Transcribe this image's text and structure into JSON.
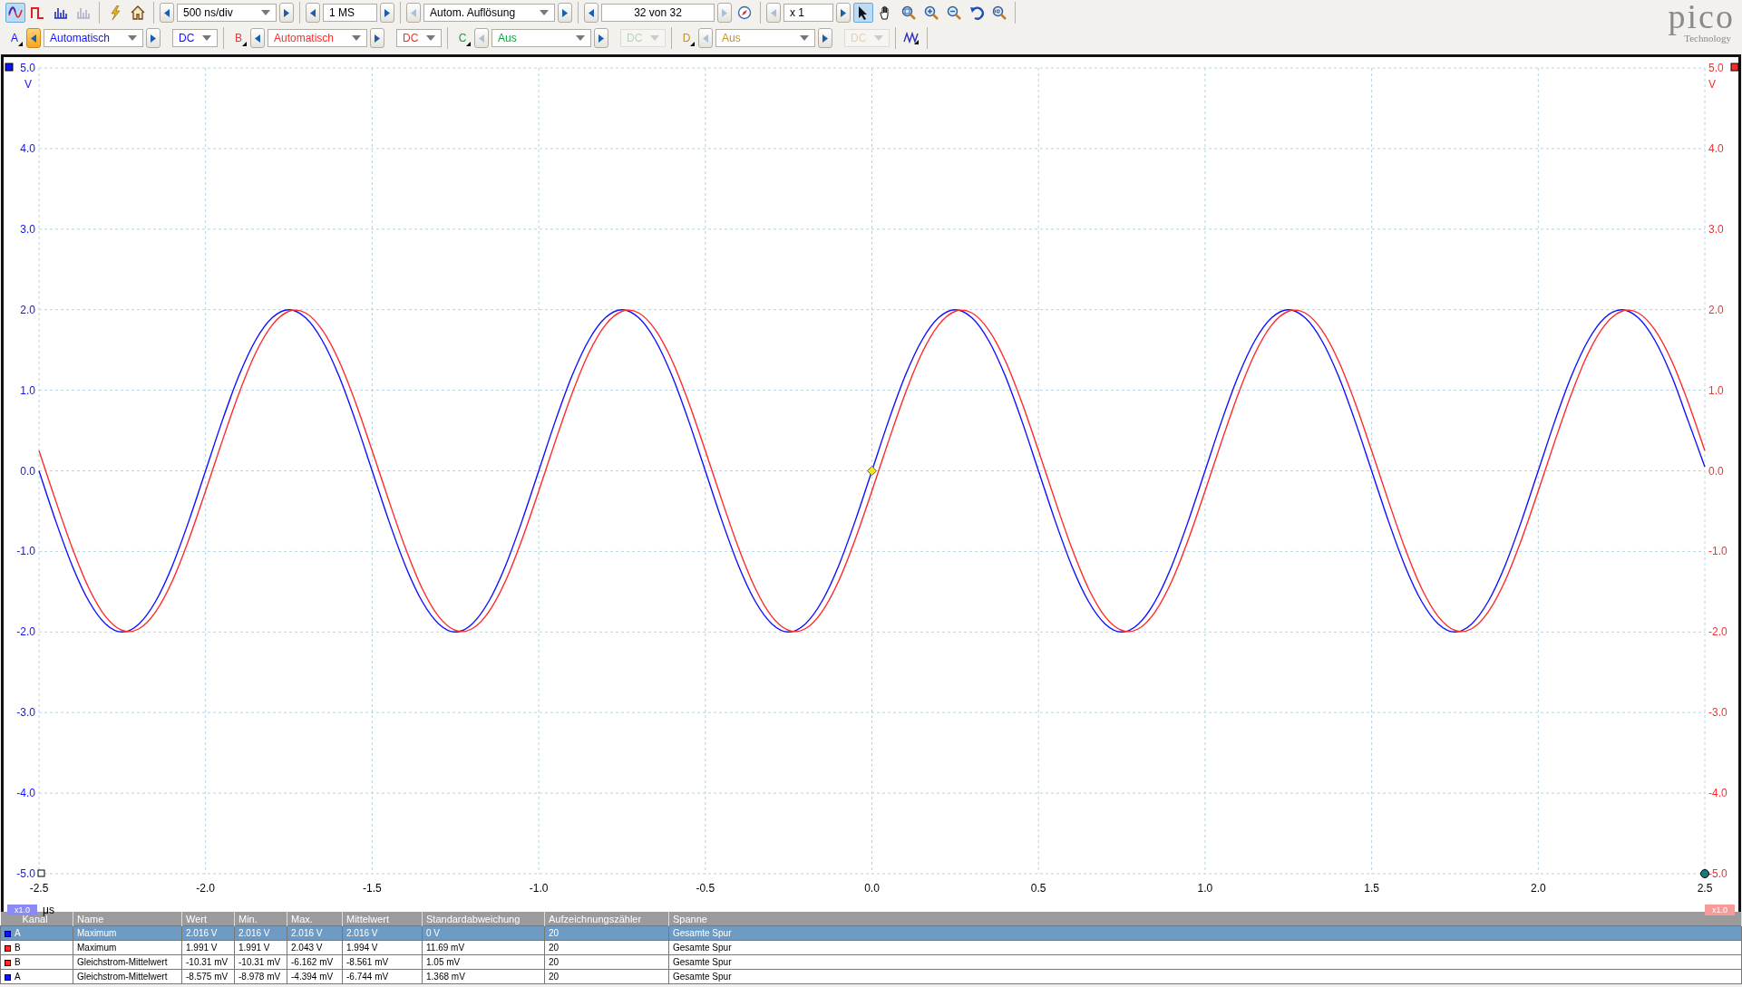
{
  "toolbar": {
    "modes": [
      {
        "kind": "scope",
        "selected": true
      },
      {
        "kind": "persistence",
        "selected": false
      },
      {
        "kind": "spectrum",
        "selected": false
      }
    ],
    "timebase": {
      "value": "500 ns/div",
      "prev_disabled": false,
      "next_disabled": false
    },
    "samples": {
      "value": "1 MS",
      "prev_disabled": false,
      "next_disabled": false
    },
    "resolution": {
      "value": "Autom. Auflösung",
      "prev_disabled": true,
      "next_disabled": false
    },
    "buffer": {
      "value": "32 von 32",
      "prev_disabled": false,
      "next_disabled": true
    },
    "zoom": {
      "value": "x 1",
      "prev_disabled": true,
      "next_disabled": false
    },
    "tools": [
      {
        "kind": "pointer",
        "selected": true
      },
      {
        "kind": "hand",
        "selected": false
      },
      {
        "kind": "zoom-area",
        "selected": false
      },
      {
        "kind": "zoom-in",
        "selected": false
      },
      {
        "kind": "zoom-out",
        "selected": false
      },
      {
        "kind": "undo",
        "selected": false
      },
      {
        "kind": "zoom-fit",
        "selected": false
      }
    ]
  },
  "channels": [
    {
      "label": "A",
      "color": "#1010ff",
      "range": "Automatisch",
      "coupling": "DC",
      "enabled": true,
      "prev_highlighted": true
    },
    {
      "label": "B",
      "color": "#ff2a2a",
      "range": "Automatisch",
      "coupling": "DC",
      "enabled": true,
      "prev_highlighted": false
    },
    {
      "label": "C",
      "color": "#10a040",
      "range": "Aus",
      "coupling": "DC",
      "enabled": false,
      "prev_highlighted": false
    },
    {
      "label": "D",
      "color": "#c89020",
      "range": "Aus",
      "coupling": "DC",
      "enabled": false,
      "prev_highlighted": false
    }
  ],
  "logo": {
    "name": "pico",
    "tagline": "Technology"
  },
  "plot": {
    "scale_left": "x1.0",
    "scale_right": "x1.0",
    "right_ylabel": "V",
    "right_yticks": [
      "5.0",
      "4.0",
      "3.0",
      "2.0",
      "1.0",
      "0.0",
      "-1.0",
      "-2.0",
      "-3.0",
      "-4.0",
      "-5.0"
    ],
    "chart_data": {
      "type": "line",
      "grid": true,
      "xlabel": "μs",
      "ylabel": "V",
      "xlim": [
        -2.5,
        2.5
      ],
      "ylim": [
        -5,
        5
      ],
      "xticks": [
        -2.5,
        {
          "value": -2,
          "label": "-2.0"
        },
        -1.5,
        {
          "value": -1,
          "label": "-1.0"
        },
        -0.5,
        {
          "value": 0,
          "label": "0.0"
        },
        0.5,
        {
          "value": 1,
          "label": "1.0"
        },
        1.5,
        {
          "value": 2,
          "label": "2.0"
        },
        2.5
      ],
      "yticks": [
        {
          "value": -5,
          "label": "-5.0"
        },
        {
          "value": -4,
          "label": "-4.0"
        },
        {
          "value": -3,
          "label": "-3.0"
        },
        {
          "value": -2,
          "label": "-2.0"
        },
        {
          "value": -1,
          "label": "-1.0"
        },
        {
          "value": 0,
          "label": "0.0"
        },
        {
          "value": 1,
          "label": "1.0"
        },
        {
          "value": 2,
          "label": "2.0"
        },
        {
          "value": 3,
          "label": "3.0"
        },
        {
          "value": 4,
          "label": "4.0"
        },
        {
          "value": 5,
          "label": "5.0"
        }
      ],
      "x": [
        -2.5,
        -2.45,
        -2.4,
        -2.35,
        -2.3,
        -2.25,
        -2.2,
        -2.15,
        -2.1,
        -2.05,
        -2,
        -1.95,
        -1.9,
        -1.85,
        -1.8,
        -1.75,
        -1.7,
        -1.65,
        -1.6,
        -1.55,
        -1.5,
        -1.45,
        -1.4,
        -1.35,
        -1.3,
        -1.25,
        -1.2,
        -1.15,
        -1.1,
        -1.05,
        -1,
        -0.95,
        -0.9,
        -0.85,
        -0.8,
        -0.75,
        -0.7,
        -0.65,
        -0.6,
        -0.55,
        -0.5,
        -0.45,
        -0.4,
        -0.35,
        -0.3,
        -0.25,
        -0.2,
        -0.15,
        -0.1,
        -0.05,
        0,
        0.05,
        0.1,
        0.15,
        0.2,
        0.25,
        0.3,
        0.35,
        0.4,
        0.45,
        0.5,
        0.55,
        0.6,
        0.65,
        0.7,
        0.75,
        0.8,
        0.85,
        0.9,
        0.95,
        1,
        1.05,
        1.1,
        1.15,
        1.2,
        1.25,
        1.3,
        1.35,
        1.4,
        1.45,
        1.5,
        1.55,
        1.6,
        1.65,
        1.7,
        1.75,
        1.8,
        1.85,
        1.9,
        1.95,
        2,
        2.05,
        2.1,
        2.15,
        2.2,
        2.25,
        2.3,
        2.35,
        2.4,
        2.45,
        2.5
      ],
      "series": [
        {
          "color": "#1010ff",
          "values": [
            0,
            -0.62,
            -1.18,
            -1.62,
            -1.9,
            -2,
            -1.9,
            -1.62,
            -1.18,
            -0.62,
            0,
            0.62,
            1.18,
            1.62,
            1.9,
            2,
            1.9,
            1.62,
            1.18,
            0.62,
            0,
            -0.62,
            -1.18,
            -1.62,
            -1.9,
            -2,
            -1.9,
            -1.62,
            -1.18,
            -0.62,
            0,
            0.62,
            1.18,
            1.62,
            1.9,
            2,
            1.9,
            1.62,
            1.18,
            0.62,
            0,
            -0.62,
            -1.18,
            -1.62,
            -1.9,
            -2,
            -1.9,
            -1.62,
            -1.18,
            -0.62,
            0,
            0.62,
            1.18,
            1.62,
            1.9,
            2,
            1.9,
            1.62,
            1.18,
            0.62,
            0,
            -0.62,
            -1.18,
            -1.62,
            -1.9,
            -2,
            -1.9,
            -1.62,
            -1.18,
            -0.62,
            0,
            0.62,
            1.18,
            1.62,
            1.9,
            2,
            1.9,
            1.62,
            1.18,
            0.62,
            0,
            -0.62,
            -1.18,
            -1.62,
            -1.9,
            -2,
            -1.9,
            -1.62,
            -1.18,
            -0.62,
            0,
            0.62,
            1.18,
            1.62,
            1.9,
            2,
            1.9,
            1.62,
            1.18,
            0.62,
            0.05
          ]
        },
        {
          "color": "#ff2a2a",
          "values": [
            0.25,
            -0.37,
            -0.96,
            -1.46,
            -1.81,
            -1.98,
            -1.96,
            -1.75,
            -1.37,
            -0.85,
            -0.25,
            0.37,
            0.96,
            1.46,
            1.81,
            1.98,
            1.96,
            1.75,
            1.37,
            0.85,
            0.25,
            -0.37,
            -0.96,
            -1.46,
            -1.81,
            -1.98,
            -1.96,
            -1.75,
            -1.37,
            -0.85,
            -0.25,
            0.37,
            0.96,
            1.46,
            1.81,
            1.98,
            1.96,
            1.75,
            1.37,
            0.85,
            0.25,
            -0.37,
            -0.96,
            -1.46,
            -1.81,
            -1.98,
            -1.96,
            -1.75,
            -1.37,
            -0.85,
            -0.25,
            0.37,
            0.96,
            1.46,
            1.81,
            1.98,
            1.96,
            1.75,
            1.37,
            0.85,
            0.25,
            -0.37,
            -0.96,
            -1.46,
            -1.81,
            -1.98,
            -1.96,
            -1.75,
            -1.37,
            -0.85,
            -0.25,
            0.37,
            0.96,
            1.46,
            1.81,
            1.98,
            1.96,
            1.75,
            1.37,
            0.85,
            0.25,
            -0.37,
            -0.96,
            -1.46,
            -1.81,
            -1.98,
            -1.96,
            -1.75,
            -1.37,
            -0.85,
            -0.25,
            0.37,
            0.96,
            1.46,
            1.81,
            1.98,
            1.96,
            1.75,
            1.37,
            0.85,
            0.25
          ]
        }
      ]
    }
  },
  "table": {
    "columns": [
      "Kanal",
      "Name",
      "Wert",
      "Min.",
      "Max.",
      "Mittelwert",
      "Standardabweichung",
      "Aufzeichnungszähler",
      "Spanne"
    ],
    "rows": [
      {
        "color": "#1010ff",
        "selected": true,
        "cells": [
          "A",
          "Maximum",
          "2.016 V",
          "2.016 V",
          "2.016 V",
          "2.016 V",
          "0 V",
          "20",
          "Gesamte Spur"
        ]
      },
      {
        "color": "#ff2a2a",
        "selected": false,
        "cells": [
          "B",
          "Maximum",
          "1.991 V",
          "1.991 V",
          "2.043 V",
          "1.994 V",
          "11.69 mV",
          "20",
          "Gesamte Spur"
        ]
      },
      {
        "color": "#ff2a2a",
        "selected": false,
        "cells": [
          "B",
          "Gleichstrom-Mittelwert",
          "-10.31 mV",
          "-10.31 mV",
          "-6.162 mV",
          "-8.561 mV",
          "1.05 mV",
          "20",
          "Gesamte Spur"
        ]
      },
      {
        "color": "#1010ff",
        "selected": false,
        "cells": [
          "A",
          "Gleichstrom-Mittelwert",
          "-8.575 mV",
          "-8.978 mV",
          "-4.394 mV",
          "-6.744 mV",
          "1.368 mV",
          "20",
          "Gesamte Spur"
        ]
      }
    ]
  }
}
